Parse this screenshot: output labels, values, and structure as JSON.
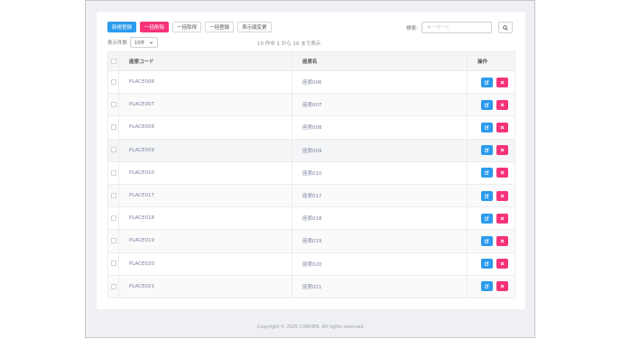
{
  "toolbar": {
    "new_label": "新規登録",
    "bulk_delete_label": "一括削除",
    "bulk_get_label": "一括取得",
    "bulk_register_label": "一括登録",
    "order_label": "表示順変更"
  },
  "search": {
    "label": "検索:",
    "placeholder": "キーワード"
  },
  "paging": {
    "count_label": "表示件数",
    "count_value": "10件",
    "info": "10 件中 1 から 10 まで表示"
  },
  "table": {
    "headers": {
      "code": "座席コード",
      "name": "座席名",
      "ops": "操作"
    },
    "rows": [
      {
        "code": "PLACE006",
        "name": "座席006"
      },
      {
        "code": "PLACE007",
        "name": "座席007"
      },
      {
        "code": "PLACE008",
        "name": "座席008"
      },
      {
        "code": "PLACE009",
        "name": "座席009"
      },
      {
        "code": "PLACE010",
        "name": "座席010"
      },
      {
        "code": "PLACE017",
        "name": "座席017"
      },
      {
        "code": "PLACE018",
        "name": "座席018"
      },
      {
        "code": "PLACE019",
        "name": "座席019"
      },
      {
        "code": "PLACE020",
        "name": "座席020"
      },
      {
        "code": "PLACE021",
        "name": "座席021"
      }
    ]
  },
  "footer": {
    "copyright": "Copyright © 2025 CASHIER. All rights reserved."
  },
  "colors": {
    "primary": "#2b9bed",
    "danger": "#f6337a"
  },
  "icons": {
    "edit": "edit-icon",
    "delete": "close-icon",
    "search": "search-icon",
    "select": "chevron-down-icon"
  }
}
